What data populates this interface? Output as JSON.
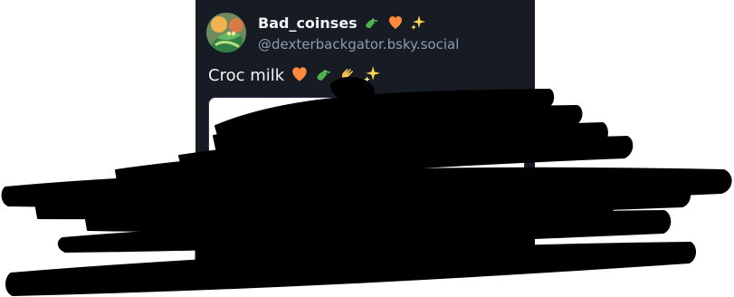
{
  "post": {
    "display_name": "Bad_coinses",
    "name_emojis": [
      "crocodile-emoji",
      "orange-heart-emoji",
      "sparkles-emoji"
    ],
    "handle": "@dexterbackgator.bsky.social",
    "text": "Croc milk",
    "text_emojis": [
      "orange-heart-emoji",
      "crocodile-emoji",
      "ok-hand-emoji",
      "sparkles-emoji"
    ]
  },
  "colors": {
    "card_background": "#171c24",
    "primary_text": "#f1f3f5",
    "secondary_text": "#8e9bab",
    "redaction": "#000000"
  }
}
